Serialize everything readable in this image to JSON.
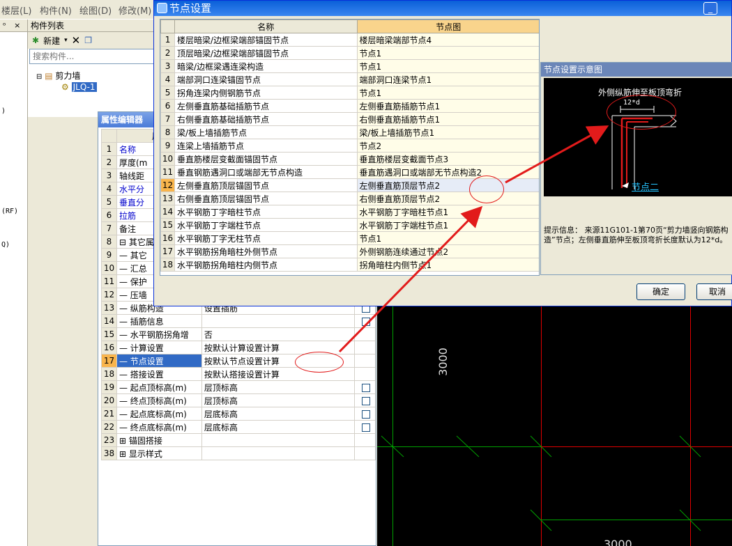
{
  "menu": [
    "楼层(L)",
    "构件(N)",
    "绘图(D)",
    "修改(M)"
  ],
  "left_panel": {
    "header_pin": "ᵒ",
    "header_close": "×",
    "labels": [
      ")",
      "(RF)",
      "Q)"
    ]
  },
  "component_list": {
    "title": "构件列表",
    "new_label": "新建",
    "search_placeholder": "搜索构件...",
    "tree_root": "剪力墙",
    "tree_child": "JLQ-1"
  },
  "property_editor": {
    "title": "属性编辑器",
    "header_col": "属性",
    "rows": [
      {
        "num": "1",
        "name": "名称",
        "value": "",
        "blue": true
      },
      {
        "num": "2",
        "name": "厚度(m",
        "value": ""
      },
      {
        "num": "3",
        "name": "轴线距",
        "value": ""
      },
      {
        "num": "4",
        "name": "水平分",
        "value": "",
        "blue": true
      },
      {
        "num": "5",
        "name": "垂直分",
        "value": "",
        "blue": true
      },
      {
        "num": "6",
        "name": "拉筋",
        "value": "",
        "blue": true
      },
      {
        "num": "7",
        "name": "备注",
        "value": ""
      },
      {
        "num": "8",
        "name": "⊟ 其它属",
        "value": ""
      },
      {
        "num": "9",
        "name": "— 其它",
        "value": ""
      },
      {
        "num": "10",
        "name": "— 汇总",
        "value": ""
      },
      {
        "num": "11",
        "name": "— 保护",
        "value": ""
      },
      {
        "num": "12",
        "name": "— 压墙",
        "value": ""
      },
      {
        "num": "13",
        "name": "— 纵筋构造",
        "value": "设置插筋",
        "check": true
      },
      {
        "num": "14",
        "name": "— 插筋信息",
        "value": "",
        "check": true
      },
      {
        "num": "15",
        "name": "— 水平钢筋拐角增",
        "value": "否"
      },
      {
        "num": "16",
        "name": "— 计算设置",
        "value": "按默认计算设置计算"
      },
      {
        "num": "17",
        "name": "— 节点设置",
        "value": "按默认节点设置计算",
        "highlight": true
      },
      {
        "num": "18",
        "name": "— 搭接设置",
        "value": "按默认搭接设置计算"
      },
      {
        "num": "19",
        "name": "— 起点顶标高(m)",
        "value": "层顶标高",
        "check": true
      },
      {
        "num": "20",
        "name": "— 终点顶标高(m)",
        "value": "层顶标高",
        "check": true
      },
      {
        "num": "21",
        "name": "— 起点底标高(m)",
        "value": "层底标高",
        "check": true
      },
      {
        "num": "22",
        "name": "— 终点底标高(m)",
        "value": "层底标高",
        "check": true
      },
      {
        "num": "23",
        "name": "⊞ 锚固搭接",
        "value": ""
      },
      {
        "num": "38",
        "name": "⊞ 显示样式",
        "value": ""
      }
    ]
  },
  "cad": {
    "dim_vertical": "3000",
    "dim_bottom": "3000"
  },
  "dialog": {
    "title": "节点设置",
    "col_name": "名称",
    "col_node": "节点图",
    "rows": [
      {
        "num": "1",
        "name": "楼层暗梁/边框梁端部锚固节点",
        "node": "楼层暗梁端部节点4"
      },
      {
        "num": "2",
        "name": "顶层暗梁/边框梁端部锚固节点",
        "node": "节点1"
      },
      {
        "num": "3",
        "name": "暗梁/边框梁遇连梁构造",
        "node": "节点1"
      },
      {
        "num": "4",
        "name": "端部洞口连梁锚固节点",
        "node": "端部洞口连梁节点1"
      },
      {
        "num": "5",
        "name": "拐角连梁内侧钢筋节点",
        "node": "节点1"
      },
      {
        "num": "6",
        "name": "左侧垂直筋基础插筋节点",
        "node": "左侧垂直筋插筋节点1"
      },
      {
        "num": "7",
        "name": "右侧垂直筋基础插筋节点",
        "node": "右侧垂直筋插筋节点1"
      },
      {
        "num": "8",
        "name": "梁/板上墙插筋节点",
        "node": "梁/板上墙插筋节点1"
      },
      {
        "num": "9",
        "name": "连梁上墙插筋节点",
        "node": "节点2"
      },
      {
        "num": "10",
        "name": "垂直筋楼层变截面锚固节点",
        "node": "垂直筋楼层变截面节点3"
      },
      {
        "num": "11",
        "name": "垂直钢筋遇洞口或端部无节点构造",
        "node": "垂直筋遇洞口或端部无节点构造2"
      },
      {
        "num": "12",
        "name": "左侧垂直筋顶层锚固节点",
        "node": "左侧垂直筋顶层节点2",
        "highlight": true
      },
      {
        "num": "13",
        "name": "右侧垂直筋顶层锚固节点",
        "node": "右侧垂直筋顶层节点2"
      },
      {
        "num": "14",
        "name": "水平钢筋丁字暗柱节点",
        "node": "水平钢筋丁字暗柱节点1"
      },
      {
        "num": "15",
        "name": "水平钢筋丁字端柱节点",
        "node": "水平钢筋丁字端柱节点1"
      },
      {
        "num": "16",
        "name": "水平钢筋丁字无柱节点",
        "node": "节点1"
      },
      {
        "num": "17",
        "name": "水平钢筋拐角暗柱外侧节点",
        "node": "外侧钢筋连续通过节点2"
      },
      {
        "num": "18",
        "name": "水平钢筋拐角暗柱内侧节点",
        "node": "拐角暗柱内侧节点1"
      }
    ],
    "diagram_title": "节点设置示意图",
    "diagram_caption": "外侧纵筋伸至板顶弯折",
    "diagram_dim": "12*d",
    "diagram_node": "节点二",
    "hint_label": "提示信息：",
    "hint_text": "来源11G101-1第70页“剪力墙竖向钢筋构造”节点；左侧垂直筋伸至板顶弯折长度默认为12*d。",
    "ok": "确定",
    "cancel": "取消"
  },
  "colors": {
    "annotation": "#e21b1b",
    "selection": "#316ac5",
    "grid_red": "#e00000",
    "grid_green": "#00a000"
  }
}
